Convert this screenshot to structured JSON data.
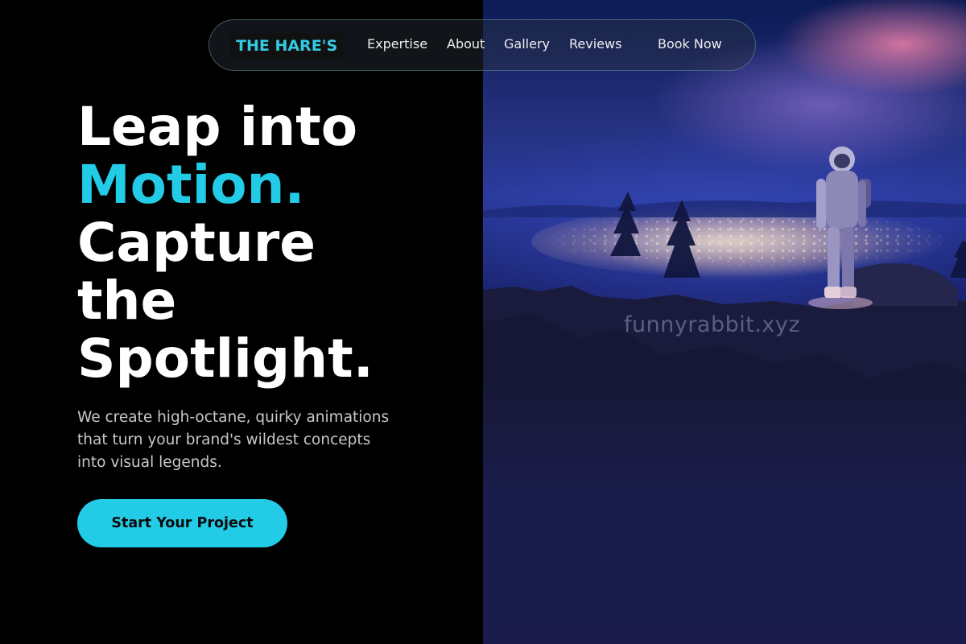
{
  "nav": {
    "brand": "THE HARE'S",
    "links": [
      "Expertise",
      "About",
      "Gallery",
      "Reviews"
    ],
    "book_label": "Book Now"
  },
  "hero": {
    "title_line_1": "Leap into",
    "title_line_2": "Motion.",
    "title_line_3": "Capture",
    "title_line_4": "the",
    "title_line_5": "Spotlight.",
    "subtitle": "We create high-octane, quirky animations that turn your brand's wildest concepts into visual legends.",
    "cta_label": "Start Your Project",
    "watermark": "funnyrabbit.xyz"
  },
  "colors": {
    "accent": "#22cbe6",
    "background": "#000000",
    "text": "#ffffff",
    "subtitle": "#c8c8c8"
  }
}
